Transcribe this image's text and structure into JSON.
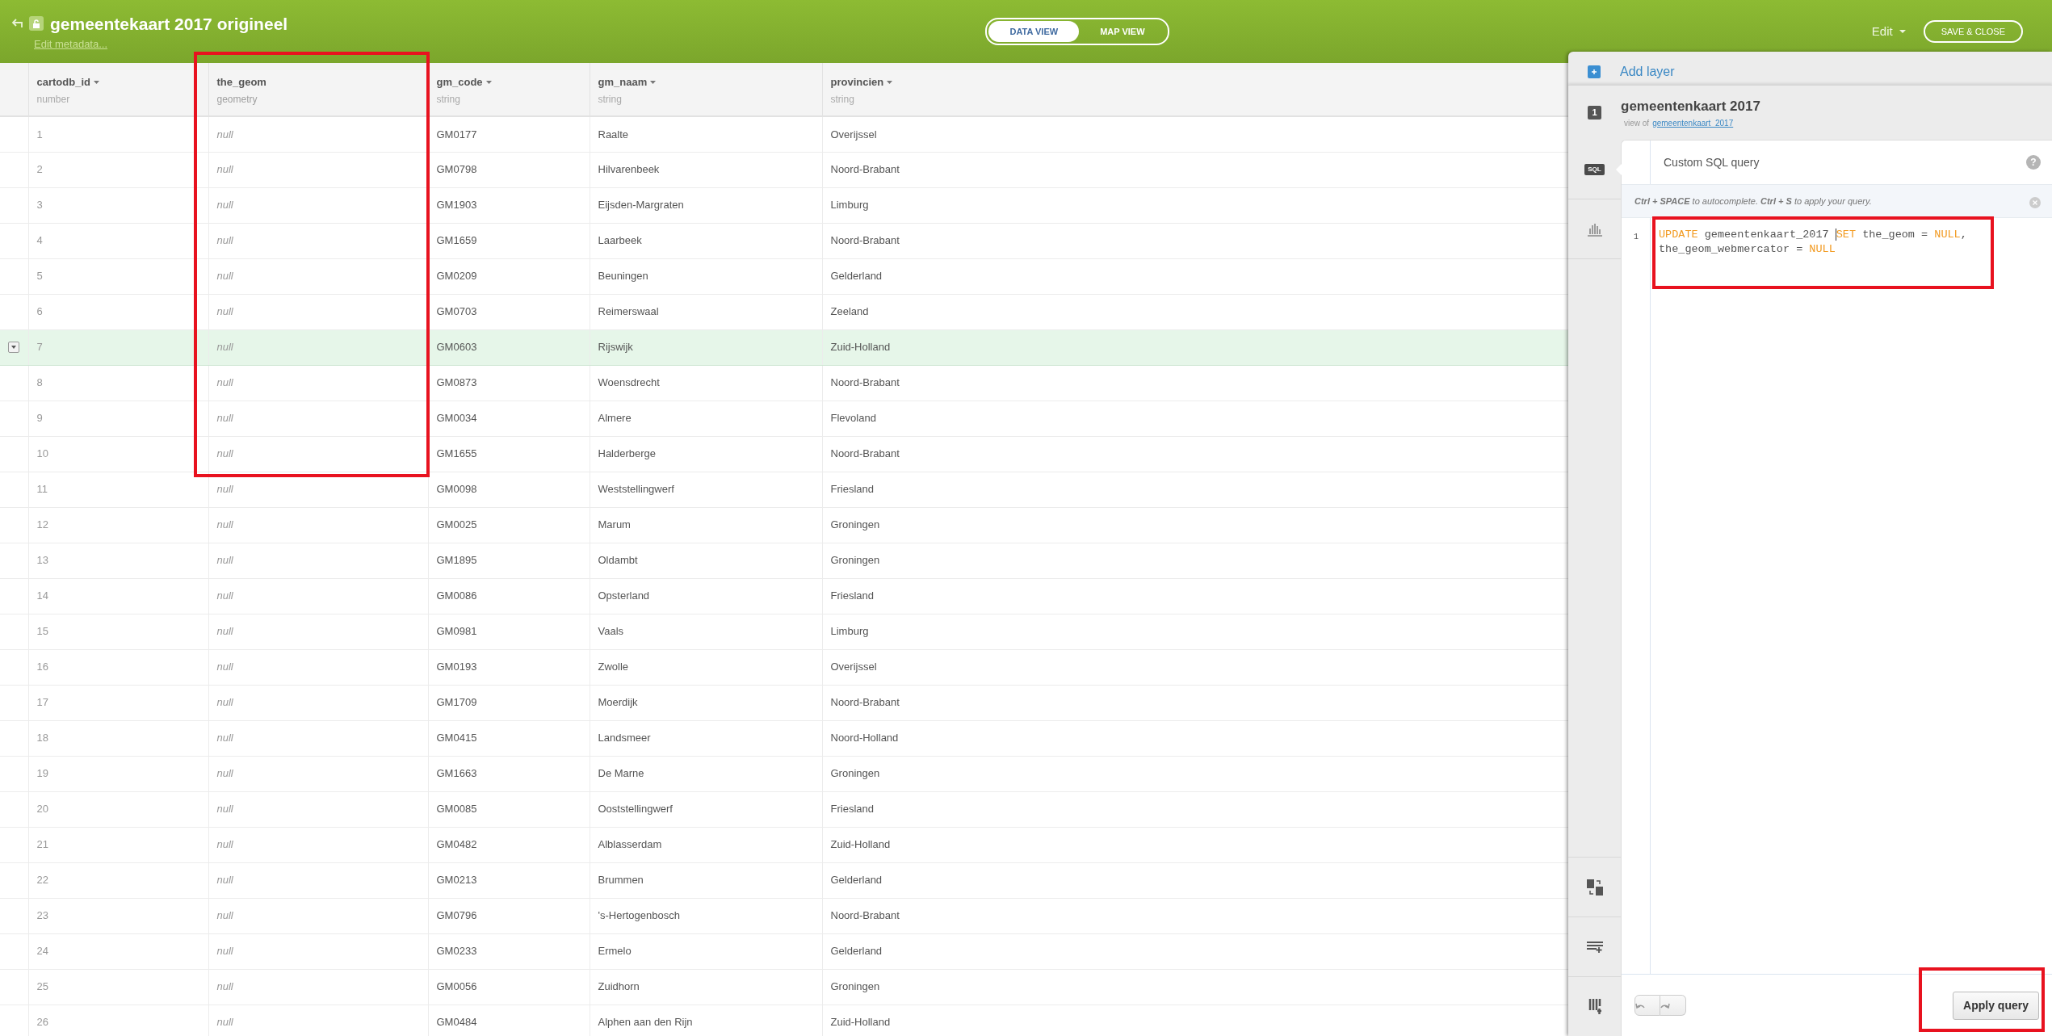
{
  "header": {
    "title": "gemeentekaart 2017 origineel",
    "subtitle": "Edit metadata...",
    "views": [
      {
        "label": "DATA VIEW",
        "selected": true
      },
      {
        "label": "MAP VIEW",
        "selected": false
      }
    ],
    "edit_menu": "Edit",
    "save_button": "SAVE & CLOSE"
  },
  "table": {
    "columns": [
      {
        "name": "cartodb_id",
        "type": "number",
        "kind": "number",
        "sortable": true
      },
      {
        "name": "the_geom",
        "type": "geometry",
        "kind": "geometry",
        "sortable": false
      },
      {
        "name": "gm_code",
        "type": "string",
        "kind": "string",
        "sortable": true
      },
      {
        "name": "gm_naam",
        "type": "string",
        "kind": "string",
        "sortable": true
      },
      {
        "name": "provincien",
        "type": "string",
        "kind": "string",
        "sortable": true
      }
    ],
    "rows": [
      {
        "cells": [
          "1",
          "null",
          "GM0177",
          "Raalte",
          "Overijssel"
        ],
        "selected": false
      },
      {
        "cells": [
          "2",
          "null",
          "GM0798",
          "Hilvarenbeek",
          "Noord-Brabant"
        ],
        "selected": false
      },
      {
        "cells": [
          "3",
          "null",
          "GM1903",
          "Eijsden-Margraten",
          "Limburg"
        ],
        "selected": false
      },
      {
        "cells": [
          "4",
          "null",
          "GM1659",
          "Laarbeek",
          "Noord-Brabant"
        ],
        "selected": false
      },
      {
        "cells": [
          "5",
          "null",
          "GM0209",
          "Beuningen",
          "Gelderland"
        ],
        "selected": false
      },
      {
        "cells": [
          "6",
          "null",
          "GM0703",
          "Reimerswaal",
          "Zeeland"
        ],
        "selected": false
      },
      {
        "cells": [
          "7",
          "null",
          "GM0603",
          "Rijswijk",
          "Zuid-Holland"
        ],
        "selected": true
      },
      {
        "cells": [
          "8",
          "null",
          "GM0873",
          "Woensdrecht",
          "Noord-Brabant"
        ],
        "selected": false
      },
      {
        "cells": [
          "9",
          "null",
          "GM0034",
          "Almere",
          "Flevoland"
        ],
        "selected": false
      },
      {
        "cells": [
          "10",
          "null",
          "GM1655",
          "Halderberge",
          "Noord-Brabant"
        ],
        "selected": false
      },
      {
        "cells": [
          "11",
          "null",
          "GM0098",
          "Weststellingwerf",
          "Friesland"
        ],
        "selected": false
      },
      {
        "cells": [
          "12",
          "null",
          "GM0025",
          "Marum",
          "Groningen"
        ],
        "selected": false
      },
      {
        "cells": [
          "13",
          "null",
          "GM1895",
          "Oldambt",
          "Groningen"
        ],
        "selected": false
      },
      {
        "cells": [
          "14",
          "null",
          "GM0086",
          "Opsterland",
          "Friesland"
        ],
        "selected": false
      },
      {
        "cells": [
          "15",
          "null",
          "GM0981",
          "Vaals",
          "Limburg"
        ],
        "selected": false
      },
      {
        "cells": [
          "16",
          "null",
          "GM0193",
          "Zwolle",
          "Overijssel"
        ],
        "selected": false
      },
      {
        "cells": [
          "17",
          "null",
          "GM1709",
          "Moerdijk",
          "Noord-Brabant"
        ],
        "selected": false
      },
      {
        "cells": [
          "18",
          "null",
          "GM0415",
          "Landsmeer",
          "Noord-Holland"
        ],
        "selected": false
      },
      {
        "cells": [
          "19",
          "null",
          "GM1663",
          "De Marne",
          "Groningen"
        ],
        "selected": false
      },
      {
        "cells": [
          "20",
          "null",
          "GM0085",
          "Ooststellingwerf",
          "Friesland"
        ],
        "selected": false
      },
      {
        "cells": [
          "21",
          "null",
          "GM0482",
          "Alblasserdam",
          "Zuid-Holland"
        ],
        "selected": false
      },
      {
        "cells": [
          "22",
          "null",
          "GM0213",
          "Brummen",
          "Gelderland"
        ],
        "selected": false
      },
      {
        "cells": [
          "23",
          "null",
          "GM0796",
          "'s-Hertogenbosch",
          "Noord-Brabant"
        ],
        "selected": false
      },
      {
        "cells": [
          "24",
          "null",
          "GM0233",
          "Ermelo",
          "Gelderland"
        ],
        "selected": false
      },
      {
        "cells": [
          "25",
          "null",
          "GM0056",
          "Zuidhorn",
          "Groningen"
        ],
        "selected": false
      },
      {
        "cells": [
          "26",
          "null",
          "GM0484",
          "Alphen aan den Rijn",
          "Zuid-Holland"
        ],
        "selected": false
      }
    ]
  },
  "panel": {
    "add_layer": "Add layer",
    "layer": {
      "number": "1",
      "title": "gemeentenkaart 2017",
      "view_of": "view of",
      "source": "gemeentenkaart_2017"
    },
    "tabs": [
      {
        "kind": "sql",
        "label": "SQL",
        "selected": true
      },
      {
        "kind": "chart",
        "selected": false
      }
    ],
    "tools": [
      {
        "kind": "merge"
      },
      {
        "kind": "add_row"
      },
      {
        "kind": "add_column"
      }
    ],
    "editor": {
      "title": "Custom SQL query",
      "help": "?",
      "hint": "**Ctrl + SPACE** to autocomplete. **Ctrl + S** to apply your query.",
      "line_number": "1",
      "wrapped_lines": [
        {
          "tokens": [
            {
              "text": "UPDATE",
              "kind": "keyword",
              "cursor": false
            },
            {
              "text": " gemeentenkaart_2017 ",
              "kind": "plain",
              "cursor": false
            },
            {
              "text": "SET",
              "kind": "keyword",
              "cursor": true
            },
            {
              "text": " the_geom = ",
              "kind": "plain",
              "cursor": false
            },
            {
              "text": "NULL",
              "kind": "keyword",
              "cursor": false
            },
            {
              "text": ",",
              "kind": "plain",
              "cursor": false
            }
          ]
        },
        {
          "tokens": [
            {
              "text": "the_geom_webmercator = ",
              "kind": "plain",
              "cursor": false
            },
            {
              "text": "NULL",
              "kind": "keyword",
              "cursor": false
            }
          ]
        }
      ]
    },
    "apply_button": "Apply query"
  },
  "annotations": [
    {
      "kind": "column"
    },
    {
      "kind": "editor"
    },
    {
      "kind": "button"
    }
  ]
}
